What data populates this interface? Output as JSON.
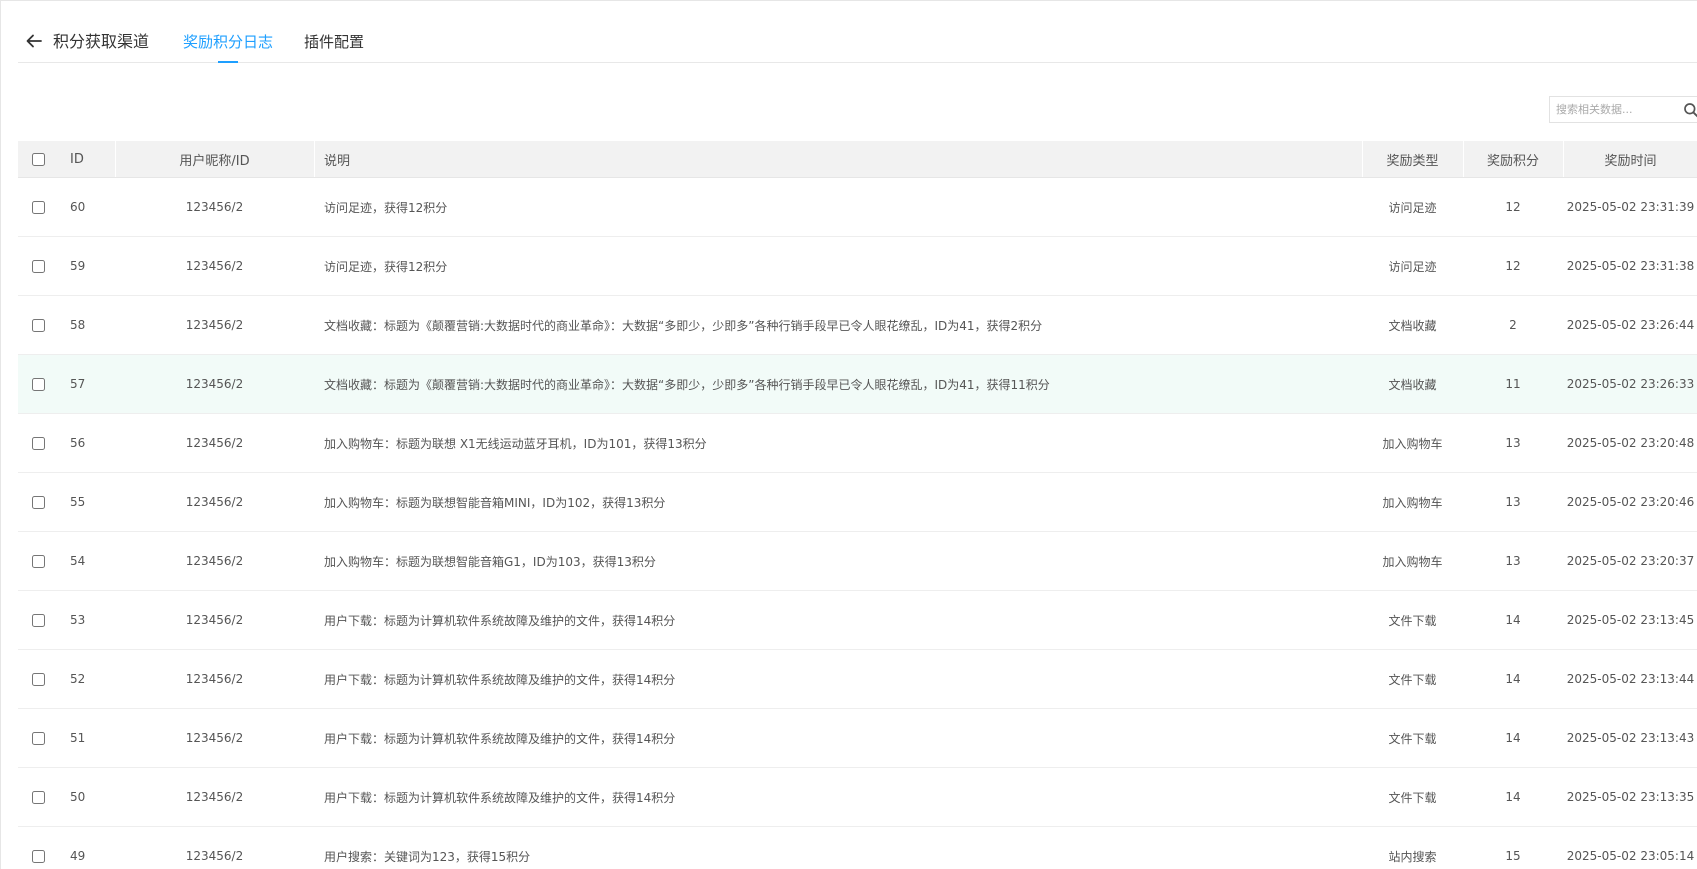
{
  "header": {
    "title": "积分获取渠道",
    "tabs": [
      {
        "label": "奖励积分日志",
        "active": true
      },
      {
        "label": "插件配置",
        "active": false
      }
    ]
  },
  "search": {
    "placeholder": "搜索相关数据...",
    "icon": "search-icon"
  },
  "colors": {
    "accent": "#1e9fff",
    "header_bg": "#f2f2f2",
    "highlight_row_bg": "#f2fbf8"
  },
  "table": {
    "columns": [
      "ID",
      "用户昵称/ID",
      "说明",
      "奖励类型",
      "奖励积分",
      "奖励时间"
    ],
    "rows": [
      {
        "id": "60",
        "user": "123456/2",
        "desc": "访问足迹，获得12积分",
        "type": "访问足迹",
        "points": "12",
        "time": "2025-05-02 23:31:39"
      },
      {
        "id": "59",
        "user": "123456/2",
        "desc": "访问足迹，获得12积分",
        "type": "访问足迹",
        "points": "12",
        "time": "2025-05-02 23:31:38"
      },
      {
        "id": "58",
        "user": "123456/2",
        "desc": "文档收藏：标题为《颠覆营销:大数据时代的商业革命》：大数据“多即少，少即多”各种行销手段早已令人眼花缭乱，ID为41，获得2积分",
        "type": "文档收藏",
        "points": "2",
        "time": "2025-05-02 23:26:44"
      },
      {
        "id": "57",
        "user": "123456/2",
        "desc": "文档收藏：标题为《颠覆营销:大数据时代的商业革命》：大数据“多即少，少即多”各种行销手段早已令人眼花缭乱，ID为41，获得11积分",
        "type": "文档收藏",
        "points": "11",
        "time": "2025-05-02 23:26:33"
      },
      {
        "id": "56",
        "user": "123456/2",
        "desc": "加入购物车：标题为联想 X1无线运动蓝牙耳机，ID为101，获得13积分",
        "type": "加入购物车",
        "points": "13",
        "time": "2025-05-02 23:20:48"
      },
      {
        "id": "55",
        "user": "123456/2",
        "desc": "加入购物车：标题为联想智能音箱MINI，ID为102，获得13积分",
        "type": "加入购物车",
        "points": "13",
        "time": "2025-05-02 23:20:46"
      },
      {
        "id": "54",
        "user": "123456/2",
        "desc": "加入购物车：标题为联想智能音箱G1，ID为103，获得13积分",
        "type": "加入购物车",
        "points": "13",
        "time": "2025-05-02 23:20:37"
      },
      {
        "id": "53",
        "user": "123456/2",
        "desc": "用户下载：标题为计算机软件系统故障及维护的文件，获得14积分",
        "type": "文件下载",
        "points": "14",
        "time": "2025-05-02 23:13:45"
      },
      {
        "id": "52",
        "user": "123456/2",
        "desc": "用户下载：标题为计算机软件系统故障及维护的文件，获得14积分",
        "type": "文件下载",
        "points": "14",
        "time": "2025-05-02 23:13:44"
      },
      {
        "id": "51",
        "user": "123456/2",
        "desc": "用户下载：标题为计算机软件系统故障及维护的文件，获得14积分",
        "type": "文件下载",
        "points": "14",
        "time": "2025-05-02 23:13:43"
      },
      {
        "id": "50",
        "user": "123456/2",
        "desc": "用户下载：标题为计算机软件系统故障及维护的文件，获得14积分",
        "type": "文件下载",
        "points": "14",
        "time": "2025-05-02 23:13:35"
      },
      {
        "id": "49",
        "user": "123456/2",
        "desc": "用户搜索：关键词为123，获得15积分",
        "type": "站内搜索",
        "points": "15",
        "time": "2025-05-02 23:05:14"
      }
    ]
  }
}
